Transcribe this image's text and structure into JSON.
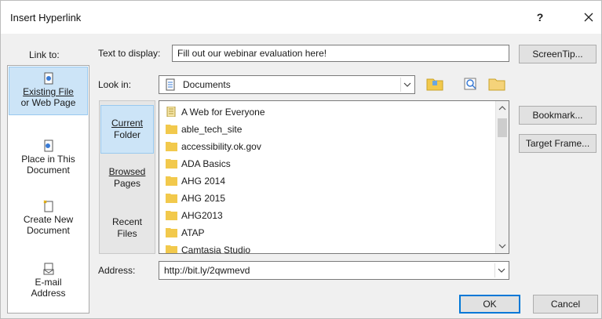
{
  "window": {
    "title": "Insert Hyperlink",
    "help": "?",
    "close": "×"
  },
  "link_to": {
    "label": "Link to:",
    "items": [
      {
        "line1": "Existing File",
        "line2": "or Web Page",
        "selected": true,
        "icon": "existing-file-icon"
      },
      {
        "line1": "Place in This",
        "line2": "Document",
        "selected": false,
        "icon": "place-in-document-icon"
      },
      {
        "line1": "Create New",
        "line2": "Document",
        "selected": false,
        "icon": "new-document-icon"
      },
      {
        "line1": "E-mail",
        "line2": "Address",
        "selected": false,
        "icon": "email-icon"
      }
    ]
  },
  "text_to_display": {
    "label": "Text to display:",
    "value": "Fill out our webinar evaluation here!"
  },
  "screentip_button": "ScreenTip...",
  "look_in": {
    "label": "Look in:",
    "value": "Documents"
  },
  "places": [
    {
      "line1": "Current",
      "line2": "Folder",
      "selected": true
    },
    {
      "line1": "Browsed",
      "line2": "Pages",
      "selected": false
    },
    {
      "line1": "Recent",
      "line2": "Files",
      "selected": false
    }
  ],
  "files": [
    {
      "name": "A Web for Everyone",
      "type": "document"
    },
    {
      "name": "able_tech_site",
      "type": "folder"
    },
    {
      "name": "accessibility.ok.gov",
      "type": "folder"
    },
    {
      "name": "ADA Basics",
      "type": "folder"
    },
    {
      "name": "AHG 2014",
      "type": "folder"
    },
    {
      "name": "AHG 2015",
      "type": "folder"
    },
    {
      "name": "AHG2013",
      "type": "folder"
    },
    {
      "name": "ATAP",
      "type": "folder"
    },
    {
      "name": "Camtasia Studio",
      "type": "folder"
    }
  ],
  "bookmark_button": "Bookmark...",
  "target_frame_button": "Target Frame...",
  "address": {
    "label": "Address:",
    "value": "http://bit.ly/2qwmevd"
  },
  "ok_button": "OK",
  "cancel_button": "Cancel",
  "colors": {
    "dialog_bg": "#f0f0f0",
    "selection": "#cce4f7",
    "folder_yellow": "#f2c94c",
    "accent": "#0078d7"
  }
}
